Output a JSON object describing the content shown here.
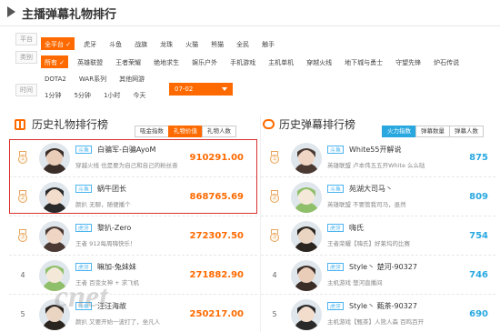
{
  "header": {
    "title": "主播弹幕礼物排行"
  },
  "filters": {
    "platform": {
      "label": "平台",
      "options": [
        "全平台",
        "虎牙",
        "斗鱼",
        "战旗",
        "龙珠",
        "火猫",
        "熊猫",
        "全民",
        "触手"
      ],
      "active": 0
    },
    "category": {
      "label": "类别",
      "options": [
        "所有",
        "英雄联盟",
        "王者荣耀",
        "绝地求生",
        "娱乐户外",
        "手机游戏",
        "主机单机",
        "穿越火线",
        "地下城与勇士",
        "守望先锋",
        "炉石传说",
        "DOTA2",
        "WAR系列",
        "其他网游"
      ],
      "active": 0
    },
    "time": {
      "label": "时间",
      "options": [
        "1分钟",
        "5分钟",
        "1小时",
        "今天"
      ],
      "date": "07-02"
    }
  },
  "gift": {
    "title": "历史礼物排行榜",
    "tabs": [
      "吸金指数",
      "礼物价值",
      "礼物人数"
    ],
    "active_tab": 1,
    "accent": "#ff6a00",
    "rows": [
      {
        "rank": "1",
        "medal": true,
        "platform": "斗鱼",
        "name": "白骗军-白骗AyoM",
        "desc": "穿越火线 也是要为自己和自己的粉丝奋",
        "value": "910291.00"
      },
      {
        "rank": "2",
        "medal": true,
        "platform": "斗鱼",
        "name": "蜗牛团长",
        "desc": "颜扒 无聊，随便播个",
        "value": "868765.69"
      },
      {
        "rank": "3",
        "medal": true,
        "platform": "虎牙",
        "name": "黎扒-Zero",
        "desc": "王者 912每周嗨快乐！",
        "value": "272307.50"
      },
      {
        "rank": "4",
        "medal": false,
        "platform": "虎牙",
        "name": "嘛加-兔妹妹",
        "desc": "王者 百变女神 + 求飞机",
        "value": "271882.90"
      },
      {
        "rank": "5",
        "medal": false,
        "platform": "斗鱼",
        "name": "汪汪海故",
        "desc": "颜扒 又要开始一波打了，坐凡人",
        "value": "250217.00"
      }
    ]
  },
  "barrage": {
    "title": "历史弹幕排行榜",
    "tabs": [
      "火力指数",
      "弹幕数量",
      "弹幕人数"
    ],
    "active_tab": 0,
    "accent": "#29a8e0",
    "rows": [
      {
        "rank": "1",
        "medal": true,
        "platform": "斗鱼",
        "name": "White55开解说",
        "desc": "英雄联盟 卢本伟五五开White 么么哒",
        "value": "875"
      },
      {
        "rank": "2",
        "medal": true,
        "platform": "斗鱼",
        "name": "苑湖大司马丶",
        "desc": "英雄联盟 不要管我司马，虽然",
        "value": "809"
      },
      {
        "rank": "3",
        "medal": true,
        "platform": "虎牙",
        "name": "嗨氏",
        "desc": "王者荣耀【嗨氏】好莱坞的比赛",
        "value": "754"
      },
      {
        "rank": "4",
        "medal": false,
        "platform": "虎牙",
        "name": "Style丶 楚河-90327",
        "desc": "主机游戏 楚河直播间",
        "value": "746"
      },
      {
        "rank": "5",
        "medal": false,
        "platform": "虎牙",
        "name": "Style丶 甄茶-90327",
        "desc": "主机游戏【甄茶】人熊人森 百鸣百开",
        "value": "690"
      }
    ]
  },
  "watermark": "cnet"
}
